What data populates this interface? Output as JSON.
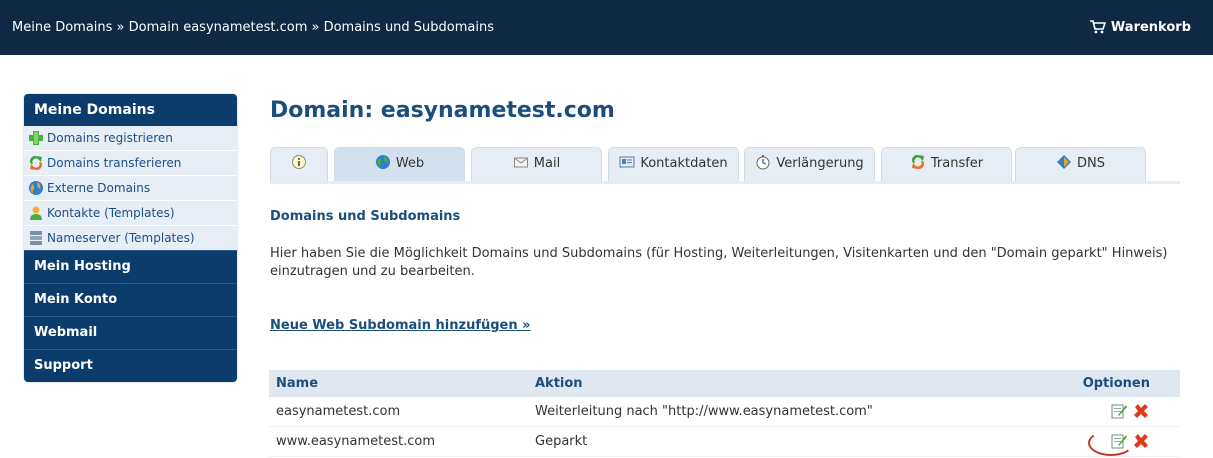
{
  "header": {
    "breadcrumb": "Meine Domains » Domain easynametest.com » Domains und Subdomains",
    "cart_label": "Warenkorb",
    "cart_icon": "cart-icon"
  },
  "sidebar": {
    "heading": "Meine Domains",
    "items": [
      {
        "label": "Domains registrieren",
        "icon": "plus-icon"
      },
      {
        "label": "Domains transferieren",
        "icon": "transfer-icon"
      },
      {
        "label": "Externe Domains",
        "icon": "globe-icon"
      },
      {
        "label": "Kontakte (Templates)",
        "icon": "user-icon"
      },
      {
        "label": "Nameserver (Templates)",
        "icon": "server-icon"
      }
    ],
    "sections": [
      "Mein Hosting",
      "Mein Konto",
      "Webmail",
      "Support"
    ]
  },
  "main": {
    "title": "Domain: easynametest.com",
    "tabs": [
      {
        "label": "",
        "icon": "info-icon"
      },
      {
        "label": "Web",
        "icon": "globe-icon",
        "active": true
      },
      {
        "label": "Mail",
        "icon": "mail-icon"
      },
      {
        "label": "Kontaktdaten",
        "icon": "contact-card-icon"
      },
      {
        "label": "Verlängerung",
        "icon": "stopwatch-icon"
      },
      {
        "label": "Transfer",
        "icon": "transfer-icon"
      },
      {
        "label": "DNS",
        "icon": "dns-icon"
      }
    ],
    "section_title": "Domains und Subdomains",
    "description": "Hier haben Sie die Möglichkeit Domains und Subdomains (für Hosting, Weiterleitungen, Visitenkarten und den \"Domain geparkt\" Hinweis) einzutragen und zu bearbeiten.",
    "add_link": "Neue Web Subdomain hinzufügen »",
    "table": {
      "headers": {
        "name": "Name",
        "action": "Aktion",
        "options": "Optionen"
      },
      "rows": [
        {
          "name": "easynametest.com",
          "action": "Weiterleitung nach \"http://www.easynametest.com\""
        },
        {
          "name": "www.easynametest.com",
          "action": "Geparkt"
        }
      ]
    }
  },
  "colors": {
    "topbar": "#0f2844",
    "sidebar": "#0c3c6c",
    "accent": "#1b4e7d",
    "tab": "#e7edf4"
  }
}
